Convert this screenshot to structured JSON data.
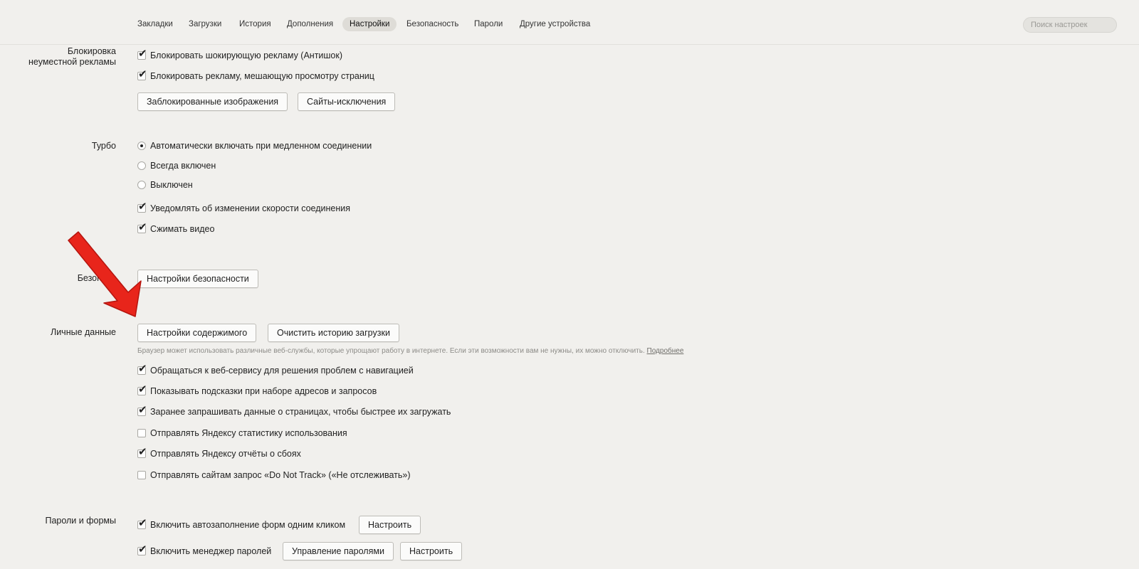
{
  "tabs": [
    "Закладки",
    "Загрузки",
    "История",
    "Дополнения",
    "Настройки",
    "Безопасность",
    "Пароли",
    "Другие устройства"
  ],
  "active_tab": "Настройки",
  "search": {
    "placeholder": "Поиск настроек"
  },
  "ad_block": {
    "label": "Блокировка неуместной рекламы",
    "options": [
      {
        "label": "Блокировать шокирующую рекламу (Антишок)",
        "checked": true
      },
      {
        "label": "Блокировать рекламу, мешающую просмотру страниц",
        "checked": true
      }
    ],
    "buttons": [
      "Заблокированные изображения",
      "Сайты-исключения"
    ]
  },
  "turbo": {
    "label": "Турбо",
    "radios": [
      {
        "label": "Автоматически включать при медленном соединении",
        "selected": true
      },
      {
        "label": "Всегда включен",
        "selected": false
      },
      {
        "label": "Выключен",
        "selected": false
      }
    ],
    "options": [
      {
        "label": "Уведомлять об изменении скорости соединения",
        "checked": true
      },
      {
        "label": "Сжимать видео",
        "checked": true
      }
    ]
  },
  "security": {
    "label": "Безопасн",
    "button": "Настройки безопасности"
  },
  "personal": {
    "label": "Личные данные",
    "buttons": [
      "Настройки содержимого",
      "Очистить историю загрузки"
    ],
    "hint": "Браузер может использовать различные веб-службы, которые упрощают работу в интернете. Если эти возможности вам не нужны, их можно отключить.",
    "hint_link": "Подробнее",
    "options": [
      {
        "label": "Обращаться к веб-сервису для решения проблем с навигацией",
        "checked": true
      },
      {
        "label": "Показывать подсказки при наборе адресов и запросов",
        "checked": true
      },
      {
        "label": "Заранее запрашивать данные о страницах, чтобы быстрее их загружать",
        "checked": true
      },
      {
        "label": "Отправлять Яндексу статистику использования",
        "checked": false
      },
      {
        "label": "Отправлять Яндексу отчёты о сбоях",
        "checked": true
      },
      {
        "label": "Отправлять сайтам запрос «Do Not Track» («Не отслеживать»)",
        "checked": false
      }
    ]
  },
  "passwords": {
    "label": "Пароли и формы",
    "autofill": {
      "label": "Включить автозаполнение форм одним кликом",
      "checked": true,
      "button": "Настроить"
    },
    "manager": {
      "label": "Включить менеджер паролей",
      "checked": true,
      "buttons": [
        "Управление паролями",
        "Настроить"
      ]
    }
  },
  "colors": {
    "arrow": "#e8251b",
    "arrow_edge": "#b5150f",
    "background": "#f1f0ed"
  }
}
